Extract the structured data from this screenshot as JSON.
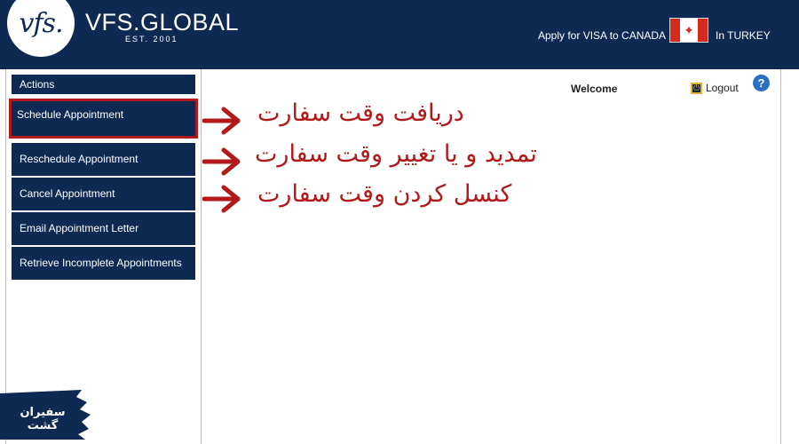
{
  "header": {
    "logo_mark": "vfs.",
    "brand": "VFS.GLOBAL",
    "brand_sub": "EST. 2001",
    "apply_text": "Apply for VISA to CANADA",
    "country_text": "In TURKEY",
    "flag_icon": "canada-flag-icon",
    "bg_color": "#0e2a52"
  },
  "sidebar": {
    "actions_label": "Actions",
    "items": [
      {
        "label": "Schedule Appointment"
      },
      {
        "label": "Reschedule Appointment"
      },
      {
        "label": "Cancel Appointment"
      },
      {
        "label": "Email Appointment Letter"
      },
      {
        "label": "Retrieve Incomplete Appointments"
      }
    ]
  },
  "topbar": {
    "welcome": "Welcome",
    "logout": "Logout",
    "help": "?"
  },
  "annotations": [
    "دریافت وقت سفارت",
    "تمدید و یا تغییر وقت سفارت",
    "کنسل کردن وقت سفارت"
  ],
  "badge": {
    "text": "سفیران گشت"
  },
  "colors": {
    "annotation_red": "#b2191a",
    "nav_blue": "#0e2a52"
  }
}
